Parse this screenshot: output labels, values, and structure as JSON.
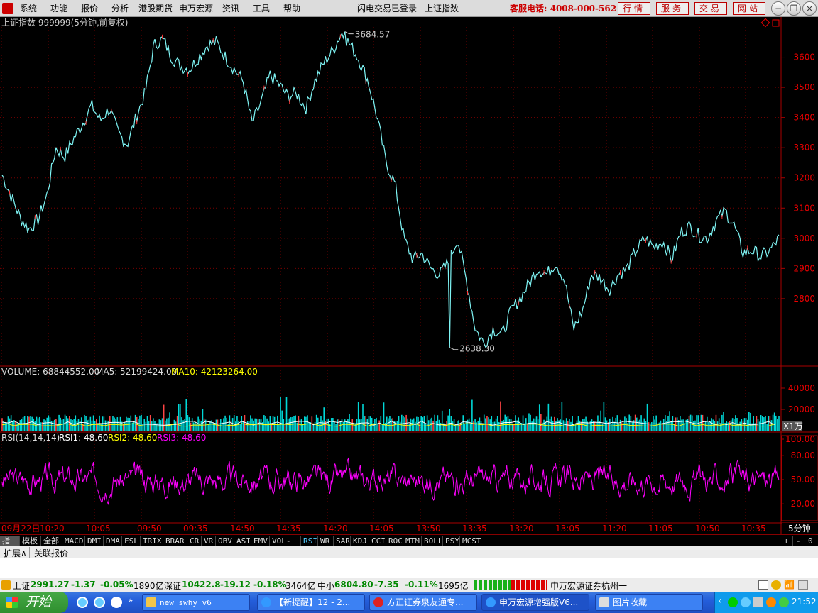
{
  "menubar": {
    "items": [
      "系统",
      "功能",
      "报价",
      "分析",
      "港股期货",
      "申万宏源",
      "资讯",
      "工具",
      "帮助"
    ],
    "center": [
      "闪电交易已登录",
      "上证指数"
    ],
    "hotline": "客服电话: 4008-000-562",
    "service_buttons": [
      "行情",
      "服务",
      "交易",
      "网站"
    ]
  },
  "chart_data": [
    {
      "type": "line",
      "title": "上证指数 999999(5分钟,前复权)",
      "ylim": [
        2600,
        3700
      ],
      "yticks": [
        2800,
        2900,
        3000,
        3100,
        3200,
        3300,
        3400,
        3500,
        3600
      ],
      "annotations": [
        {
          "label": "3684.57",
          "value": 3684.57
        },
        {
          "label": "2638.30",
          "value": 2638.3
        }
      ],
      "xticks": [
        "09月22日",
        "10:20",
        "10:05",
        "09:50",
        "09:35",
        "14:50",
        "14:35",
        "14:20",
        "14:05",
        "13:50",
        "13:35",
        "13:20",
        "13:05",
        "11:20",
        "11:05",
        "10:50",
        "10:35"
      ],
      "anchors": [
        3210,
        3140,
        3070,
        3030,
        3060,
        3140,
        3300,
        3270,
        3330,
        3380,
        3440,
        3390,
        3430,
        3350,
        3310,
        3400,
        3480,
        3640,
        3660,
        3600,
        3570,
        3560,
        3600,
        3640,
        3650,
        3600,
        3560,
        3520,
        3380,
        3450,
        3540,
        3510,
        3470,
        3480,
        3430,
        3520,
        3580,
        3620,
        3680,
        3640,
        3590,
        3520,
        3400,
        3250,
        3180,
        3000,
        2930,
        2950,
        2900,
        2880,
        2920,
        3000,
        2860,
        2700,
        2650,
        2700,
        2680,
        2760,
        2800,
        2850,
        2900,
        2880,
        2920,
        2860,
        2700,
        2760,
        2880,
        2870,
        2830,
        2880,
        2900,
        2960,
        3000,
        2970,
        2990,
        2930,
        3020,
        3040,
        3010,
        3000,
        3060,
        3090,
        3040,
        2950,
        2960,
        2940,
        2960,
        3000
      ],
      "line_color": "#7ff5f5"
    },
    {
      "type": "bar",
      "title": "VOLUME",
      "labels": {
        "volume": "VOLUME: 68844552.00",
        "ma5": "MA5: 52199424.00",
        "ma10": "MA10: 42123264.00"
      },
      "yticks": [
        "40000",
        "20000"
      ],
      "ylim": [
        0,
        50000
      ],
      "unit": "X1万",
      "bar_color": "#00d8d8",
      "ma_colors": [
        "#ffffff",
        "#ffff00"
      ]
    },
    {
      "type": "line",
      "title": "RSI(14,14,14)",
      "labels": {
        "rsi1": "RSI1: 48.60",
        "rsi2": "RSI2: 48.60",
        "rsi3": "RSI3: 48.60"
      },
      "yticks": [
        "100.00",
        "80.00",
        "50.00",
        "20.00"
      ],
      "ylim": [
        0,
        100
      ],
      "line_color": "#ff00ff"
    }
  ],
  "yticks_text": [
    "3600",
    "3500",
    "3400",
    "3300",
    "3200",
    "3100",
    "3000",
    "2900",
    "2800"
  ],
  "indicator_tabs": [
    "指标",
    "模板",
    "全部",
    "MACD",
    "DMI",
    "DMA",
    "FSL",
    "TRIX",
    "BRAR",
    "CR",
    "VR",
    "OBV",
    "ASI",
    "EMV",
    "VOL-TDX",
    "RSI",
    "WR",
    "SAR",
    "KDJ",
    "CCI",
    "ROC",
    "MTM",
    "BOLL",
    "PSY",
    "MCST"
  ],
  "active_tab": "RSI",
  "period_label": "5分钟",
  "zoom_controls": [
    "+",
    "-",
    "0"
  ],
  "sub_tabs": [
    "扩展∧",
    "关联报价"
  ],
  "status": {
    "sh": {
      "label": "上证",
      "price": "2991.27",
      "chg": "-1.37",
      "pct": "-0.05%",
      "amt": "1890亿"
    },
    "sz": {
      "label": "深证",
      "price": "10422.8",
      "chg": "-19.12",
      "pct": "-0.18%",
      "amt": "3464亿"
    },
    "zx": {
      "label": "中小",
      "price": "6804.80",
      "chg": "-7.35",
      "pct": "-0.11%",
      "amt": "1695亿"
    },
    "broker": "申万宏源证券杭州一"
  },
  "taskbar": {
    "start": "开始",
    "tasks": [
      "new_swhy_v6",
      "【新提醒】12 - 2...",
      "方正证券泉友通专...",
      "申万宏源增强版V6...",
      "图片收藏"
    ],
    "time": "21:52"
  }
}
